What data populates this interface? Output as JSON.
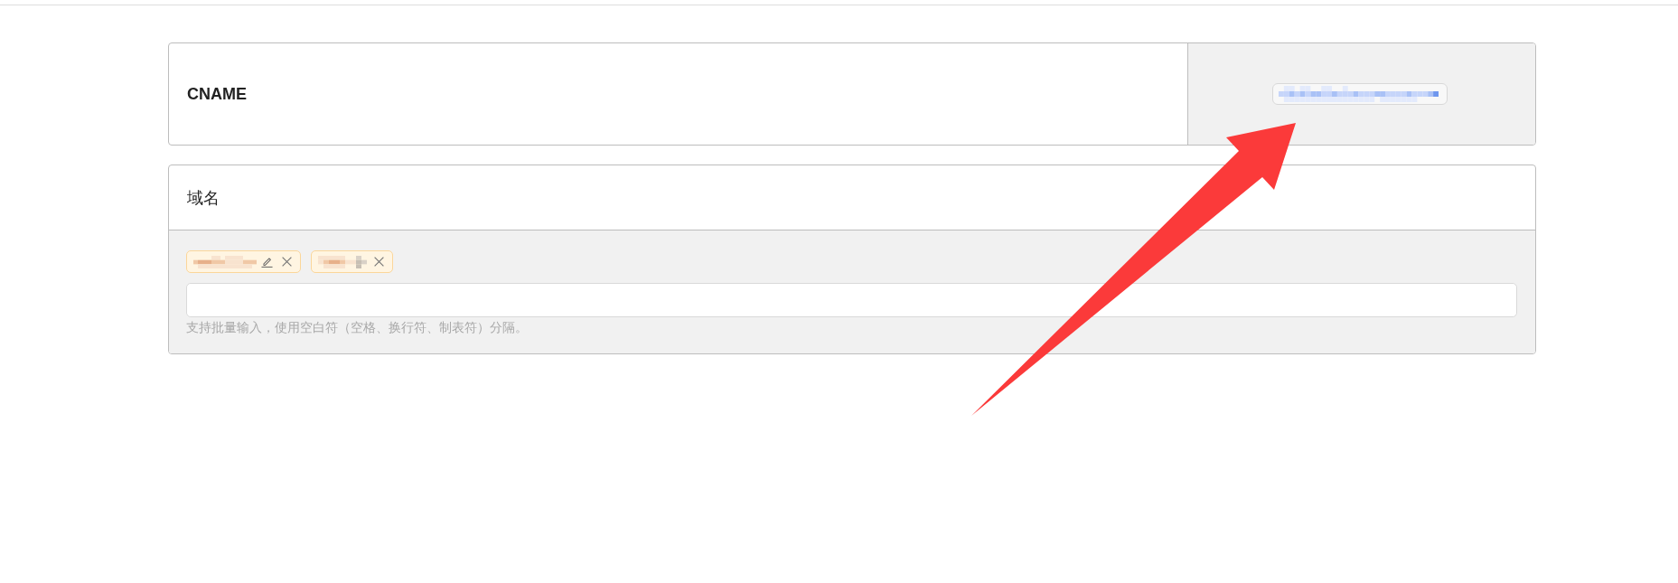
{
  "cname_row": {
    "label": "CNAME"
  },
  "domain_panel": {
    "title": "域名",
    "tags": [
      {
        "editable": true
      },
      {
        "editable": false
      }
    ],
    "hint": "支持批量输入，使用空白符（空格、换行符、制表符）分隔。"
  }
}
